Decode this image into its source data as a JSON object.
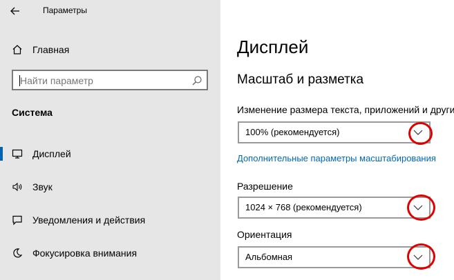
{
  "app": {
    "title": "Параметры",
    "back_icon": "back-arrow-icon"
  },
  "sidebar": {
    "home_label": "Главная",
    "search_placeholder": "Найти параметр",
    "section_title": "Система",
    "items": [
      {
        "label": "Дисплей",
        "icon": "display-icon",
        "active": true
      },
      {
        "label": "Звук",
        "icon": "speaker-icon",
        "active": false
      },
      {
        "label": "Уведомления и действия",
        "icon": "notification-icon",
        "active": false
      },
      {
        "label": "Фокусировка внимания",
        "icon": "moon-icon",
        "active": false
      }
    ]
  },
  "main": {
    "page_title": "Дисплей",
    "section_title": "Масштаб и разметка",
    "scale": {
      "label": "Изменение размера текста, приложений и други",
      "value": "100% (рекомендуется)"
    },
    "advanced_link": "Дополнительные параметры масштабирования",
    "resolution": {
      "label": "Разрешение",
      "value": "1024 × 768 (рекомендуется)"
    },
    "orientation": {
      "label": "Ориентация",
      "value": "Альбомная"
    }
  },
  "colors": {
    "sidebar_bg": "#e6e6e6",
    "accent": "#0063b1",
    "link": "#0067b8",
    "highlight_circle": "#e00000"
  }
}
